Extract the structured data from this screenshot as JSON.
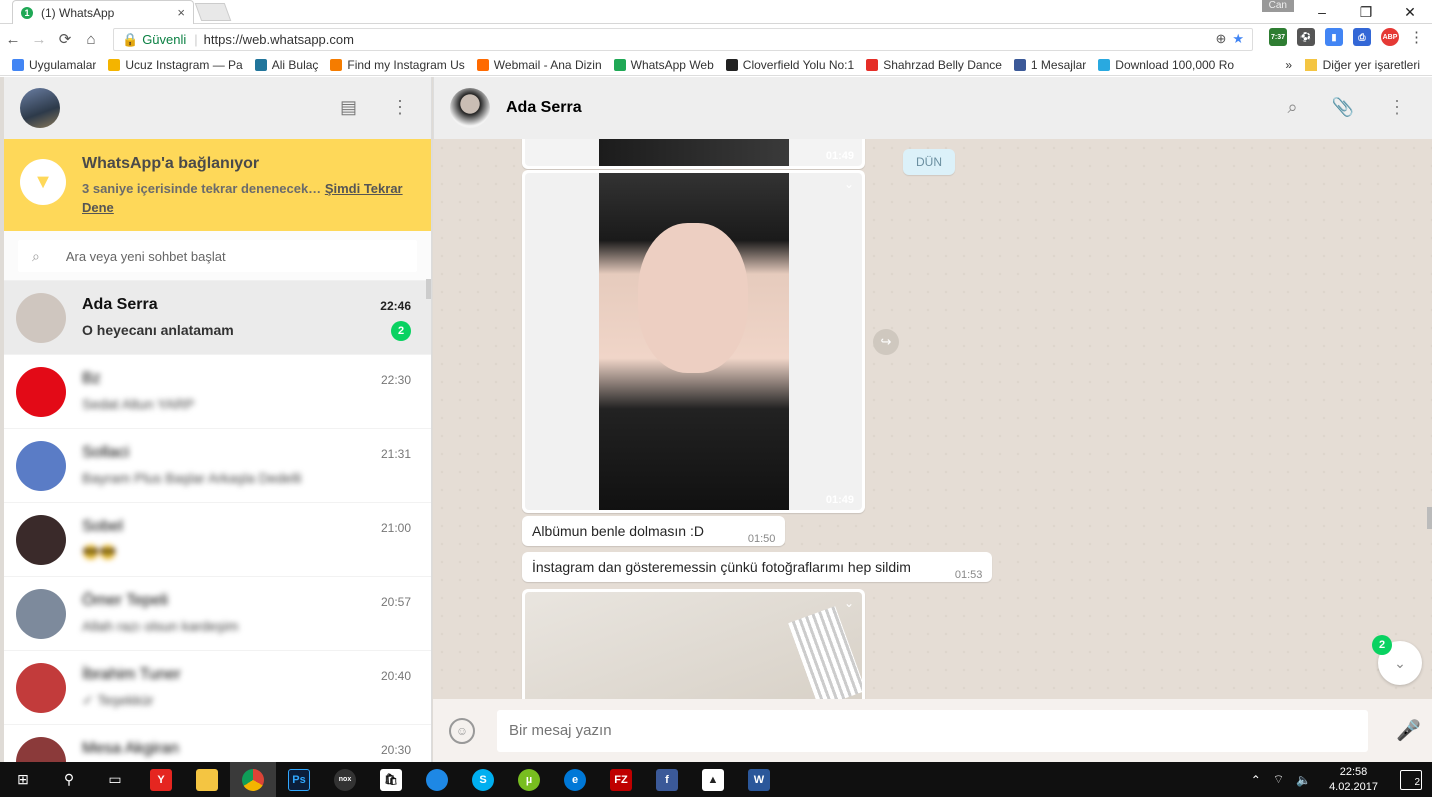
{
  "browser": {
    "tab_title": "(1) WhatsApp",
    "tab_badge": "1",
    "tab_close": "×",
    "user_chip": "Can",
    "window_controls": [
      "–",
      "❐",
      "✕"
    ],
    "secure_label": "Güvenli",
    "url": "https://web.whatsapp.com",
    "bookmarks": [
      {
        "label": "Uygulamalar",
        "color": "#4285f4"
      },
      {
        "label": "Ucuz Instagram — Pa",
        "color": "#f4b400"
      },
      {
        "label": "Ali Bulaç",
        "color": "#21759b"
      },
      {
        "label": "Find my Instagram Us",
        "color": "#f57c00"
      },
      {
        "label": "Webmail - Ana Dizin",
        "color": "#ff6a00"
      },
      {
        "label": "WhatsApp Web",
        "color": "#1fa855"
      },
      {
        "label": "Cloverfield Yolu No:1",
        "color": "#222222"
      },
      {
        "label": "Shahrzad Belly Dance",
        "color": "#e52d27"
      },
      {
        "label": "1 Mesajlar",
        "color": "#3b5998"
      },
      {
        "label": "Download 100,000 Ro",
        "color": "#29a9e0"
      }
    ],
    "bookmarks_more": "»",
    "bookmarks_other": "Diğer yer işaretleri",
    "ext_badge": "7:37"
  },
  "sidebar": {
    "banner": {
      "title": "WhatsApp'a bağlanıyor",
      "subtitle": "3 saniye içerisinde tekrar denenecek…",
      "link": "Şimdi Tekrar Dene"
    },
    "search_placeholder": "Ara veya yeni sohbet başlat",
    "chats": [
      {
        "name": "Ada Serra",
        "last": "O heyecanı anlatamam",
        "time": "22:46",
        "badge": "2",
        "active": true,
        "avatar": "#cfc6bf"
      },
      {
        "name": "Bz",
        "last": "Sedat Altun YARP",
        "time": "22:30",
        "avatar": "#e30a17"
      },
      {
        "name": "Sollaci",
        "last": "Bayram Plus Başlar Arkaşla Dedelli",
        "time": "21:31",
        "avatar": "#5a7cc6"
      },
      {
        "name": "Sobel",
        "last": "😎😎",
        "time": "21:00",
        "avatar": "#3a2a2a"
      },
      {
        "name": "Ömer Tepeli",
        "last": "Allah razı olsun kardeşim",
        "time": "20:57",
        "avatar": "#7d8a9c"
      },
      {
        "name": "İbrahim Tuner",
        "last": "✓ Teşekkür",
        "time": "20:40",
        "avatar": "#c23b3b"
      },
      {
        "name": "Mesa Akgiran",
        "last": "",
        "time": "20:30",
        "avatar": "#8b3a3a"
      }
    ]
  },
  "conversation": {
    "contact_name": "Ada Serra",
    "date_chip": "DÜN",
    "images": [
      {
        "time": "01:49"
      },
      {
        "time": "01:49"
      }
    ],
    "text_messages": [
      {
        "text": "Albümun benle dolmasın :D",
        "time": "01:50"
      },
      {
        "text": "İnstagram dan gösteremessin çünkü fotoğraflarımı hep sildim",
        "time": "01:53"
      }
    ],
    "unread_scroll_badge": "2",
    "composer_placeholder": "Bir mesaj yazın"
  },
  "taskbar": {
    "clock_time": "22:58",
    "clock_date": "4.02.2017",
    "notification_count": "2"
  }
}
